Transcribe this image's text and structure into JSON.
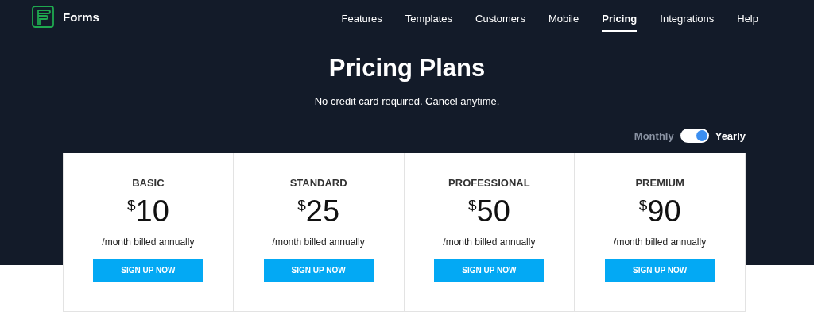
{
  "brand": {
    "name": "Forms"
  },
  "nav": [
    {
      "label": "Features",
      "selected": false
    },
    {
      "label": "Templates",
      "selected": false
    },
    {
      "label": "Customers",
      "selected": false
    },
    {
      "label": "Mobile",
      "selected": false
    },
    {
      "label": "Pricing",
      "selected": true
    },
    {
      "label": "Integrations",
      "selected": false
    },
    {
      "label": "Help",
      "selected": false
    }
  ],
  "title": "Pricing Plans",
  "subtitle": "No credit card required. Cancel anytime.",
  "billing": {
    "monthly_label": "Monthly",
    "yearly_label": "Yearly",
    "yearly": true
  },
  "plans": [
    {
      "name": "BASIC",
      "currency": "$",
      "price": "10",
      "period": "/month billed annually",
      "button": "SIGN UP NOW"
    },
    {
      "name": "STANDARD",
      "currency": "$",
      "price": "25",
      "period": "/month billed annually",
      "button": "SIGN UP NOW"
    },
    {
      "name": "PROFESSIONAL",
      "currency": "$",
      "price": "50",
      "period": "/month billed annually",
      "button": "SIGN UP NOW"
    },
    {
      "name": "PREMIUM",
      "currency": "$",
      "price": "90",
      "period": "/month billed annually",
      "button": "SIGN UP NOW"
    }
  ]
}
